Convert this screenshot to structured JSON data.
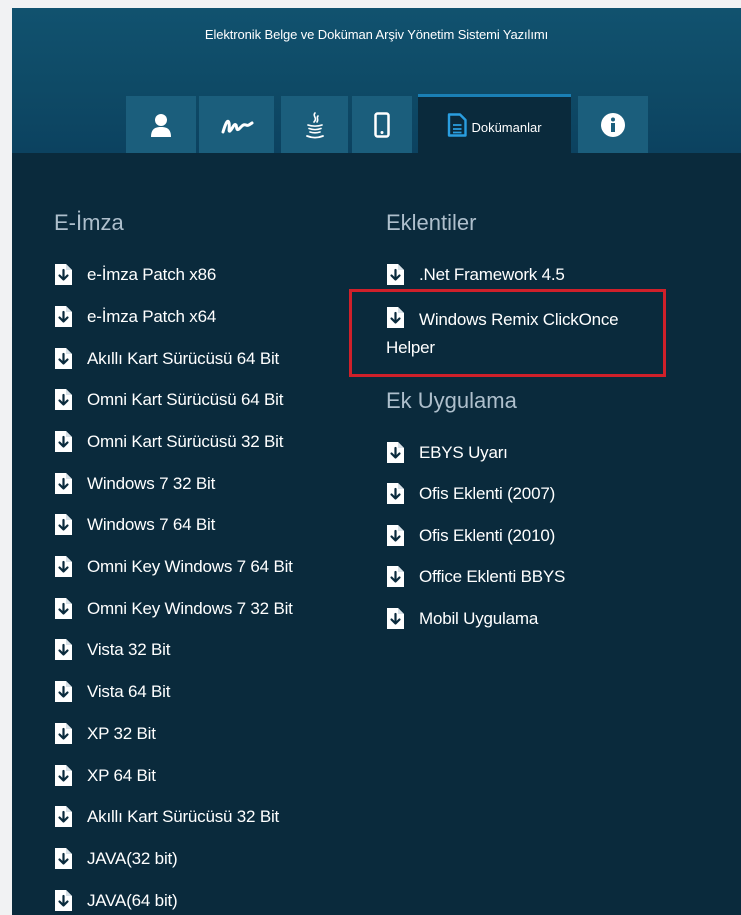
{
  "app_title": "Elektronik Belge ve Doküman Arşiv Yönetim Sistemi Yazılımı",
  "tabs": [
    {
      "icon": "user-icon"
    },
    {
      "icon": "signature-icon"
    },
    {
      "icon": "java-icon"
    },
    {
      "icon": "mobile-icon"
    },
    {
      "icon": "document-icon",
      "label": "Dokümanlar",
      "active": true
    },
    {
      "icon": "info-icon"
    }
  ],
  "eimza": {
    "title": "E-İmza",
    "items": [
      "e-İmza Patch x86",
      "e-İmza Patch x64",
      "Akıllı Kart Sürücüsü 64 Bit",
      "Omni Kart Sürücüsü 64 Bit",
      "Omni Kart Sürücüsü 32 Bit",
      "Windows 7 32 Bit",
      "Windows 7 64 Bit",
      "Omni Key Windows 7 64 Bit",
      "Omni Key Windows 7 32 Bit",
      "Vista 32 Bit",
      "Vista 64 Bit",
      "XP 32 Bit",
      "XP 64 Bit",
      "Akıllı Kart Sürücüsü 32 Bit",
      "JAVA(32 bit)",
      "JAVA(64 bit)"
    ]
  },
  "eklentiler": {
    "title": "Eklentiler",
    "items": [
      ".Net Framework 4.5",
      "Windows Remix ClickOnce Helper"
    ]
  },
  "ek_uygulama": {
    "title": "Ek Uygulama",
    "items": [
      "EBYS Uyarı",
      "Ofis Eklenti (2007)",
      "Ofis Eklenti (2010)",
      "Office Eklenti BBYS",
      "Mobil Uygulama"
    ]
  },
  "colors": {
    "header": "#0e4a66",
    "tab": "#1b5e7c",
    "panel": "#0a2a3c",
    "highlight": "#d0202a"
  }
}
